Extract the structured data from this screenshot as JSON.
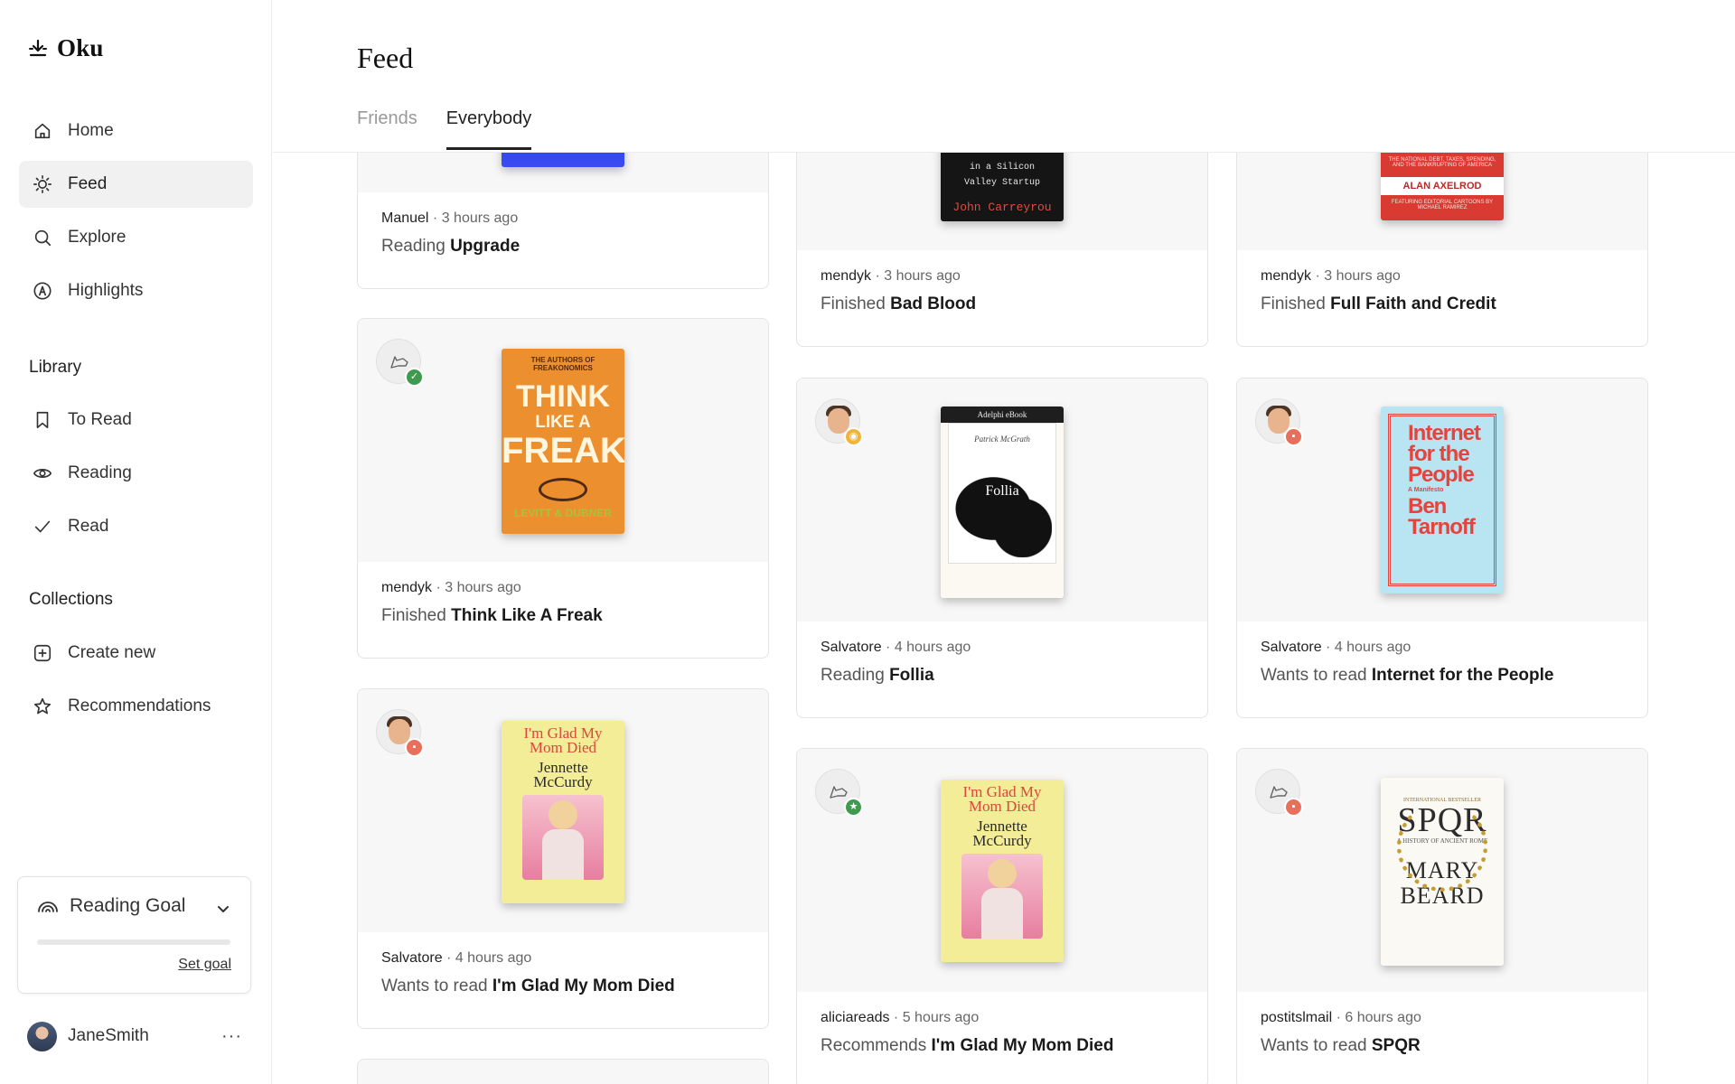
{
  "app": {
    "name": "Oku"
  },
  "sidebar": {
    "nav": [
      {
        "label": "Home",
        "icon": "home-icon"
      },
      {
        "label": "Feed",
        "icon": "sun-icon",
        "active": true
      },
      {
        "label": "Explore",
        "icon": "search-icon"
      },
      {
        "label": "Highlights",
        "icon": "highlight-icon"
      }
    ],
    "library_label": "Library",
    "library": [
      {
        "label": "To Read",
        "icon": "bookmark-icon"
      },
      {
        "label": "Reading",
        "icon": "eye-icon"
      },
      {
        "label": "Read",
        "icon": "check-icon"
      }
    ],
    "collections_label": "Collections",
    "collections": [
      {
        "label": "Create new",
        "icon": "plus-square-icon"
      },
      {
        "label": "Recommendations",
        "icon": "star-icon"
      }
    ],
    "goal": {
      "title": "Reading Goal",
      "link": "Set goal",
      "progress": 0
    },
    "user": {
      "name": "JaneSmith",
      "more": "···"
    }
  },
  "main": {
    "title": "Feed",
    "tabs": [
      {
        "label": "Friends",
        "active": false
      },
      {
        "label": "Everybody",
        "active": true
      }
    ]
  },
  "feed": [
    {
      "user": "Manuel",
      "time": "3 hours ago",
      "action": "Reading",
      "book": "Upgrade"
    },
    {
      "user": "mendyk",
      "time": "3 hours ago",
      "action": "Finished",
      "book": "Bad Blood",
      "cover_text": [
        "in a Silicon",
        "Valley Startup",
        "John Carreyrou"
      ]
    },
    {
      "user": "mendyk",
      "time": "3 hours ago",
      "action": "Finished",
      "book": "Full Faith and Credit",
      "cover_text": [
        "THE NATIONAL DEBT, TAXES, SPENDING, AND THE BANKRUPTING OF AMERICA",
        "ALAN AXELROD",
        "FEATURING EDITORIAL CARTOONS BY MICHAEL RAMIREZ"
      ]
    },
    {
      "user": "mendyk",
      "time": "3 hours ago",
      "action": "Finished",
      "book": "Think Like A Freak",
      "status": "finished",
      "cover_text": [
        "THE AUTHORS OF FREAKONOMICS",
        "THINK",
        "LIKE A",
        "FREAK",
        "LEVITT & DUBNER"
      ]
    },
    {
      "user": "Salvatore",
      "time": "4 hours ago",
      "action": "Reading",
      "book": "Follia",
      "status": "reading",
      "cover_text": [
        "Adelphi eBook",
        "Patrick McGrath",
        "Follia"
      ]
    },
    {
      "user": "Salvatore",
      "time": "4 hours ago",
      "action": "Wants to read",
      "book": "Internet for the People",
      "status": "want",
      "cover_text": [
        "Internet",
        "for the",
        "People",
        "A Manifesto",
        "Ben",
        "Tarnoff"
      ]
    },
    {
      "user": "Salvatore",
      "time": "4 hours ago",
      "action": "Wants to read",
      "book": "I'm Glad My Mom Died",
      "status": "want",
      "cover_text": [
        "I'm Glad My",
        "Mom Died",
        "Jennette",
        "McCurdy"
      ]
    },
    {
      "user": "aliciareads",
      "time": "5 hours ago",
      "action": "Recommends",
      "book": "I'm Glad My Mom Died",
      "status": "recommend",
      "cover_text": [
        "I'm Glad My",
        "Mom Died",
        "Jennette",
        "McCurdy"
      ]
    },
    {
      "user": "postitslmail",
      "time": "6 hours ago",
      "action": "Wants to read",
      "book": "SPQR",
      "status": "want",
      "cover_text": [
        "INTERNATIONAL BESTSELLER",
        "SPQR",
        "A HISTORY OF ANCIENT ROME",
        "MARY",
        "BEARD"
      ]
    }
  ],
  "colors": {
    "accent": "#222222",
    "finished_badge": "#3f9a50",
    "want_badge": "#e86f5b",
    "reading_badge": "#f1b43b"
  }
}
